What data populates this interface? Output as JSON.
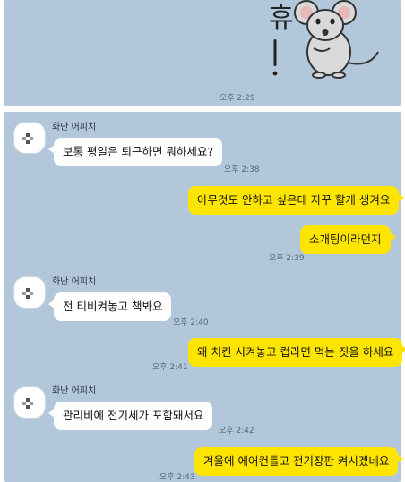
{
  "top": {
    "sticker_text": "휴",
    "time": "오후 2:29"
  },
  "messages": [
    {
      "sender": "화난 어피치",
      "text": "보통 평일은 퇴근하면 뭐하세요?",
      "time": "오후 2:38"
    },
    {
      "text": "아무것도 안하고 싶은데 자꾸 할게 생겨요"
    },
    {
      "text": "소개팅이라던지",
      "time": "오후 2:39"
    },
    {
      "sender": "화난 어피치",
      "text": "전 티비켜놓고 책봐요",
      "time": "오후 2:40"
    },
    {
      "text": "왜 치킨 시켜놓고 컵라면 먹는 짓을 하세요",
      "time": "오후 2:41"
    },
    {
      "sender": "화난 어피치",
      "text": "관리비에 전기세가 포함돼서요",
      "time": "오후 2:42"
    },
    {
      "text": "겨울에 에어컨틀고 전기장판 켜시겠네요",
      "time": "오후 2:43"
    }
  ],
  "colors": {
    "chat_bg": "#b2c7da",
    "incoming_bubble": "#ffffff",
    "outgoing_bubble": "#fee500"
  }
}
